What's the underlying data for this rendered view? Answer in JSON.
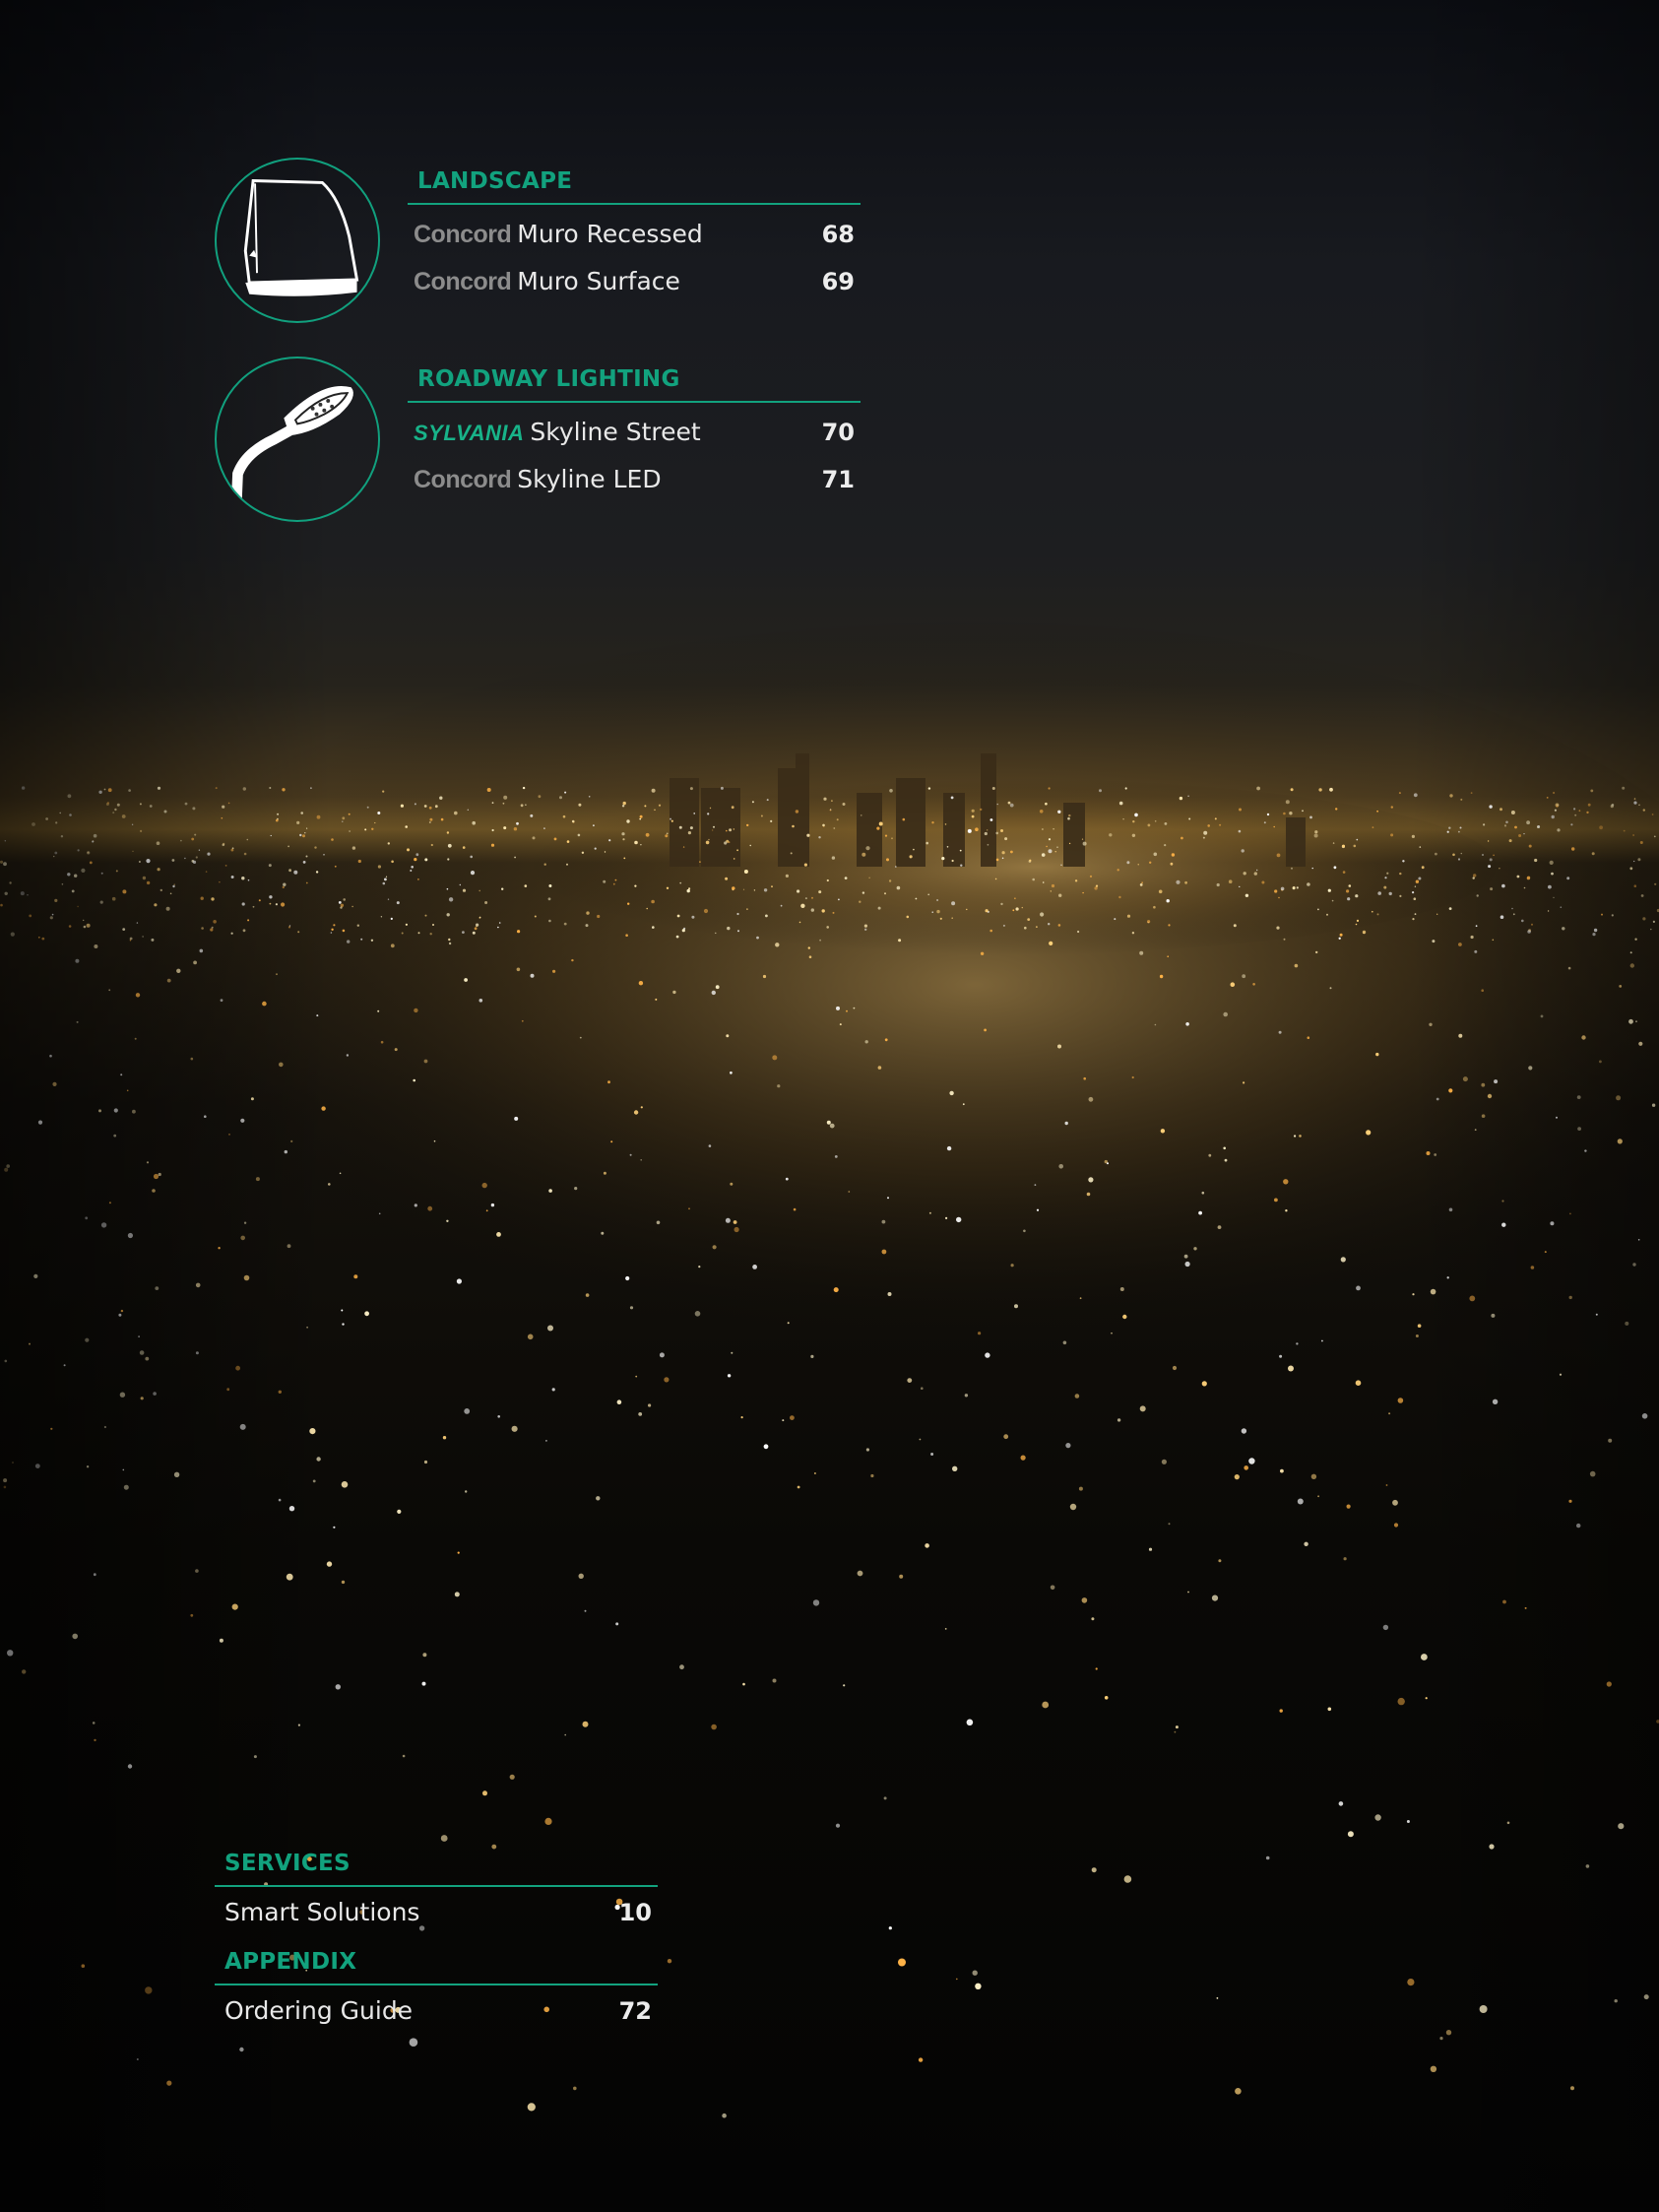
{
  "sections": [
    {
      "title": "LANDSCAPE",
      "icon": "wall-pack-fixture-icon",
      "items": [
        {
          "brand": "Concord",
          "name": "Muro Recessed",
          "page": "68"
        },
        {
          "brand": "Concord",
          "name": "Muro Surface",
          "page": "69"
        }
      ]
    },
    {
      "title": "ROADWAY LIGHTING",
      "icon": "street-light-icon",
      "items": [
        {
          "brand": "SYLVANIA",
          "name": "Skyline Street",
          "page": "70"
        },
        {
          "brand": "Concord",
          "name": "Skyline LED",
          "page": "71"
        }
      ]
    }
  ],
  "services": {
    "title": "SERVICES",
    "items": [
      {
        "name": "Smart Solutions",
        "page": "10"
      }
    ]
  },
  "appendix": {
    "title": "APPENDIX",
    "items": [
      {
        "name": "Ordering Guide",
        "page": "72"
      }
    ]
  },
  "colors": {
    "accent": "#12a27e",
    "text": "#e6e6e6",
    "brand_grey": "#8c8c8c"
  }
}
